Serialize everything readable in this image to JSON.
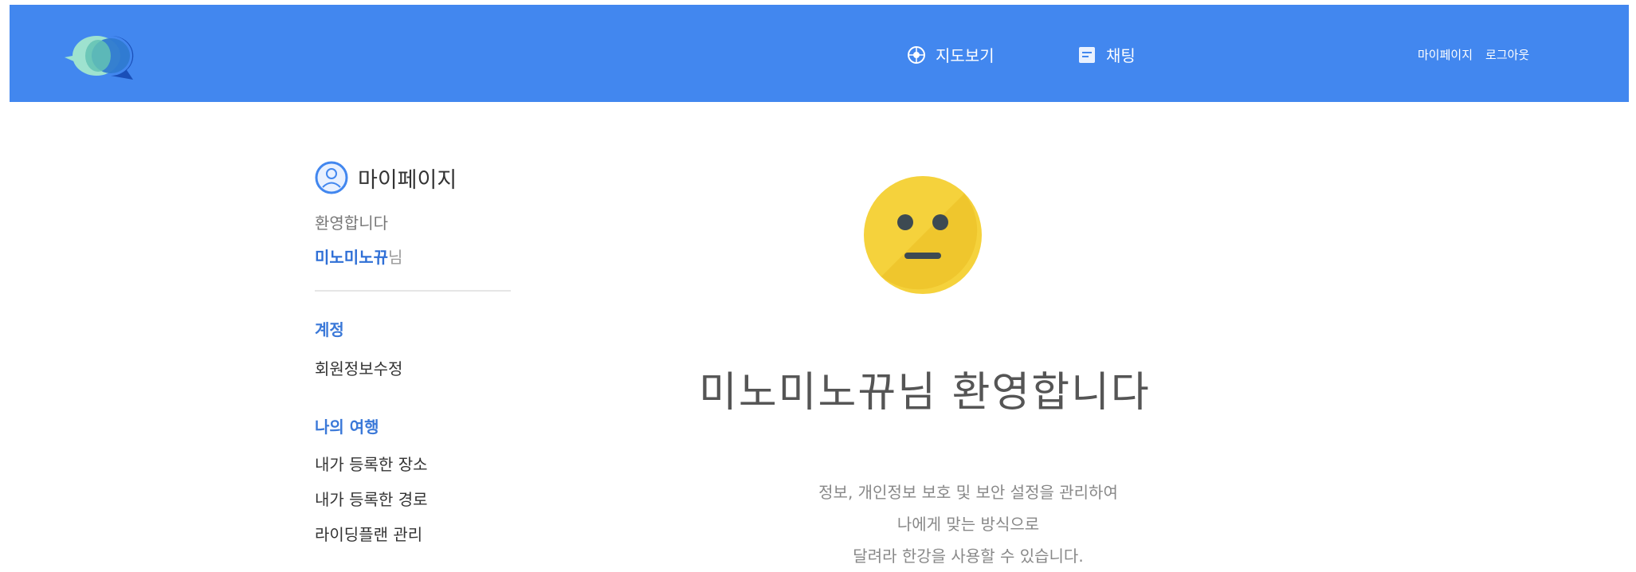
{
  "nav": {
    "map_label": "지도보기",
    "chat_label": "채팅",
    "mypage_link": "마이페이지",
    "logout_link": "로그아웃"
  },
  "sidebar": {
    "title": "마이페이지",
    "welcome": "환영합니다",
    "user_name": "미노미노뀨",
    "user_suffix": "님",
    "sections": [
      {
        "title": "계정",
        "items": [
          "회원정보수정"
        ]
      },
      {
        "title": "나의 여행",
        "items": [
          "내가 등록한 장소",
          "내가 등록한 경로",
          "라이딩플랜 관리"
        ]
      }
    ]
  },
  "main": {
    "welcome_title": "미노미노뀨님 환영합니다",
    "description_lines": [
      "정보, 개인정보 보호 및 보안 설정을 관리하여",
      "나에게 맞는 방식으로",
      "달려라 한강을 사용할 수 있습니다."
    ]
  },
  "colors": {
    "header": "#4287ef",
    "accent": "#3a78d8",
    "emoji": "#f5d23c"
  },
  "icons": {
    "logo": "speech-bubbles-logo",
    "map": "compass-icon",
    "chat": "chat-icon",
    "profile": "user-avatar-icon",
    "emoji": "neutral-face-icon"
  }
}
